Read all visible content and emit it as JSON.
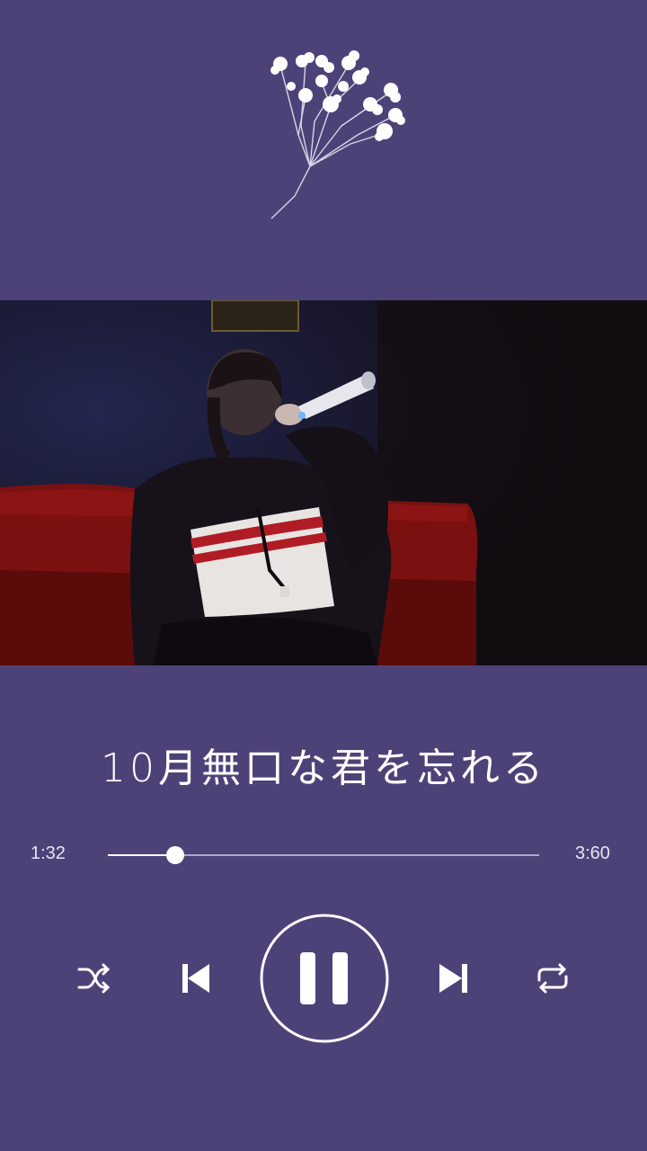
{
  "song": {
    "title": "10月無口な君を忘れる"
  },
  "player": {
    "current_time": "1:32",
    "total_time": "3:60",
    "progress": 0.156,
    "state": "playing"
  },
  "controls": {
    "shuffle": "shuffle-icon",
    "previous": "skip-previous-icon",
    "play_pause": "pause-icon",
    "next": "skip-next-icon",
    "repeat": "repeat-icon"
  },
  "colors": {
    "background": "#4d4278",
    "foreground": "#ffffff"
  }
}
